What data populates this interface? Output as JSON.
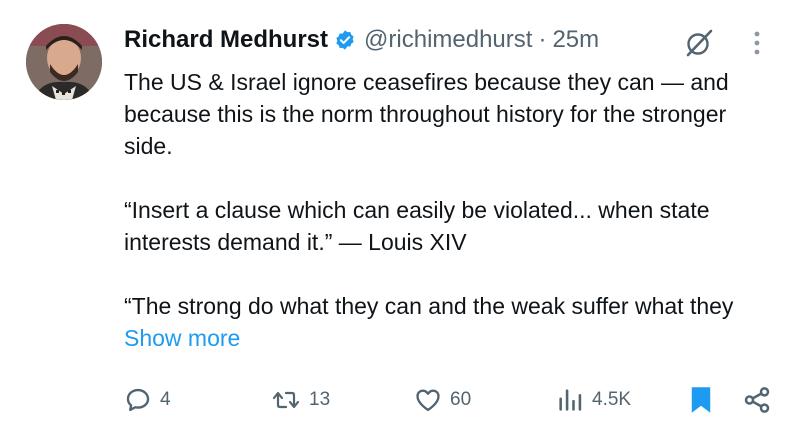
{
  "author": {
    "name": "Richard Medhurst",
    "handle": "@richimedhurst",
    "separator": "·",
    "time": "25m",
    "verified": true
  },
  "tweet": {
    "paragraphs": [
      "The US & Israel ignore ceasefires because they can — and because this is the norm throughout history for the stronger side.",
      "“Insert a clause which can easily be violated... when state interests demand it.” — Louis XIV"
    ],
    "last_paragraph": "“The strong do what they can and the weak suffer what they ",
    "show_more": "Show more"
  },
  "actions": {
    "replies": "4",
    "reposts": "13",
    "likes": "60",
    "views": "4.5K"
  },
  "icons": {
    "verified": "verified-badge-icon",
    "grok": "grok-icon",
    "more": "more-options-icon",
    "reply": "reply-icon",
    "repost": "repost-icon",
    "like": "heart-icon",
    "views": "views-chart-icon",
    "bookmark": "bookmark-icon",
    "share": "share-icon"
  },
  "colors": {
    "text": "#0f1419",
    "secondary": "#536471",
    "accent": "#1d9bf0"
  }
}
